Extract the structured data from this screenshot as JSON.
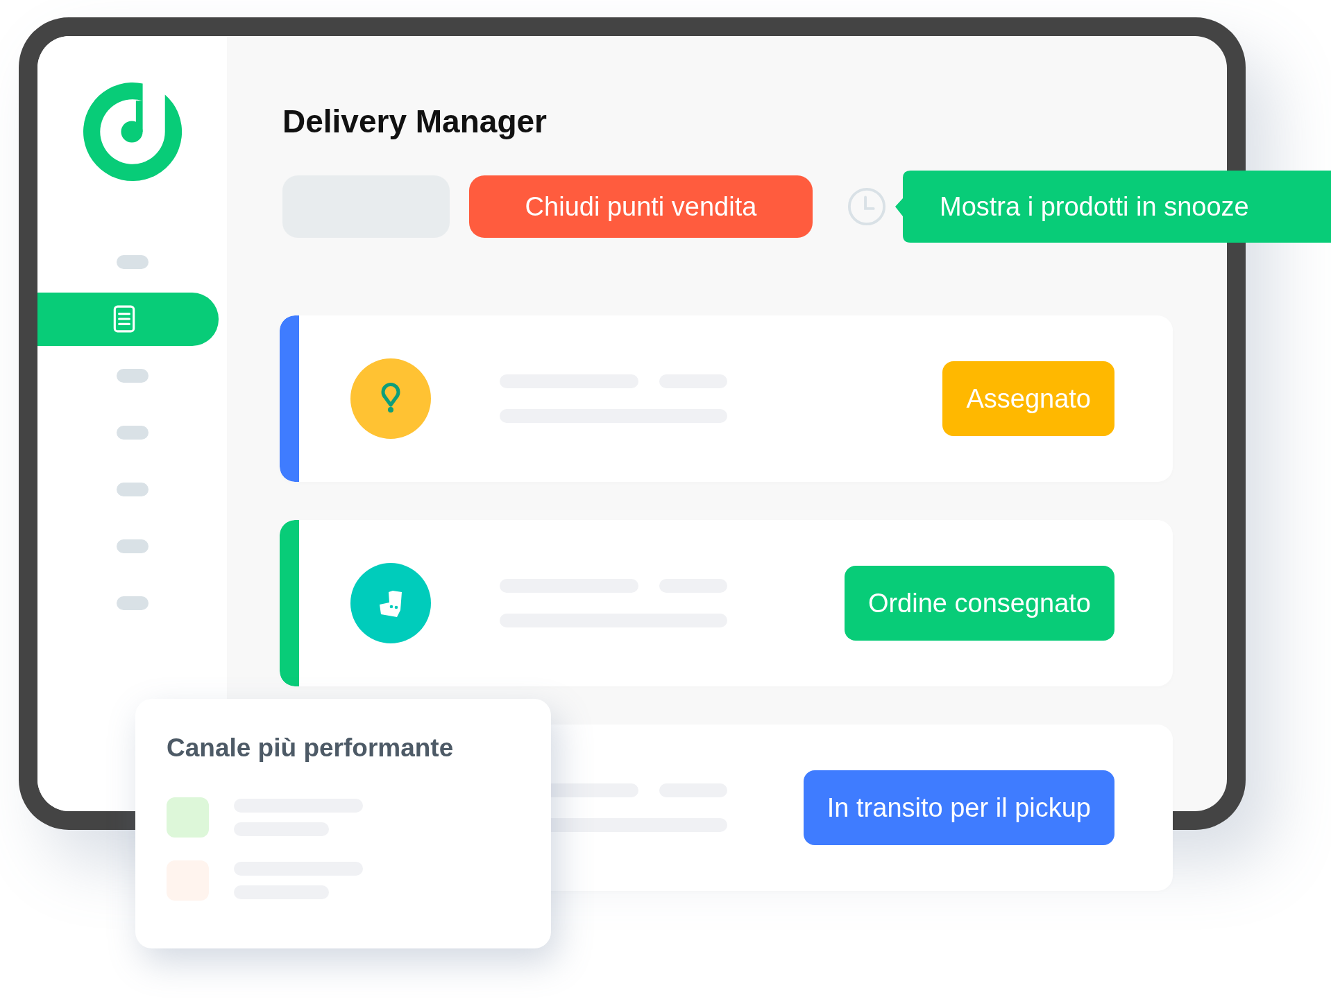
{
  "app": {
    "title": "Delivery Manager"
  },
  "sidebar": {
    "items": [
      {
        "kind": "placeholder",
        "selected": false
      },
      {
        "kind": "orders",
        "selected": true
      },
      {
        "kind": "placeholder",
        "selected": false
      },
      {
        "kind": "placeholder",
        "selected": false
      },
      {
        "kind": "placeholder",
        "selected": false
      },
      {
        "kind": "placeholder",
        "selected": false
      },
      {
        "kind": "placeholder",
        "selected": false
      }
    ]
  },
  "toolbar": {
    "close_button": "Chiudi punti vendita",
    "tooltip": "Mostra i prodotti in snooze"
  },
  "orders": [
    {
      "accent": {
        "color": "#3f7cff"
      },
      "kind": "pin",
      "status": "Assegnato",
      "color": "#ffb800"
    },
    {
      "accent": {
        "color": "#08cc78"
      },
      "kind": "kangaroo",
      "status": "Ordine consegnato",
      "color": "#08cc78"
    },
    {
      "status": "In transito per il pickup",
      "color": "#3f7cff"
    }
  ],
  "channel_card": {
    "title": "Canale più performante",
    "entries": [
      {
        "color": "#ddf7d9"
      },
      {
        "color": "#fff4ee"
      }
    ]
  }
}
